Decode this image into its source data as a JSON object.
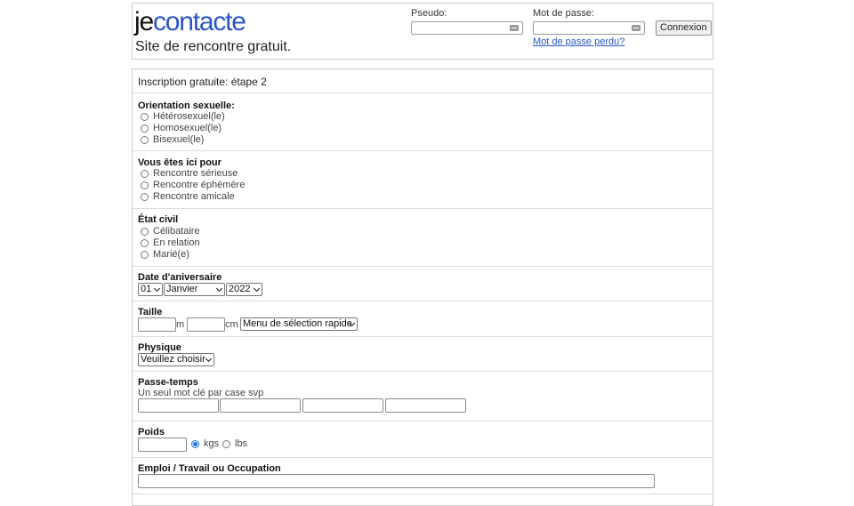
{
  "header": {
    "logo_je": "je",
    "logo_contact": "contacte",
    "tagline": "Site de rencontre gratuit.",
    "pseudo_label": "Pseudo:",
    "password_label": "Mot de passe:",
    "login_button": "Connexion",
    "forgot_link": "Mot de passe perdu?"
  },
  "form": {
    "title": "Inscription gratuite: étape 2",
    "orientation": {
      "title": "Orientation sexuelle:",
      "options": [
        "Hétérosexuel(le)",
        "Homosexuel(le)",
        "Bisexuel(le)"
      ]
    },
    "purpose": {
      "title": "Vous êtes ici pour",
      "options": [
        "Rencontre sérieuse",
        "Rencontre éphémère",
        "Rencontre amicale"
      ]
    },
    "civil": {
      "title": "État civil",
      "options": [
        "Célibataire",
        "En relation",
        "Marié(e)"
      ]
    },
    "birthday": {
      "title": "Date d'aniversaire",
      "day": "01",
      "month": "Janvier",
      "year": "2022"
    },
    "height": {
      "title": "Taille",
      "unit_m": "m",
      "unit_cm": "cm",
      "quick_select": "Menu de sélection rapide"
    },
    "physique": {
      "title": "Physique",
      "select": "Veuillez choisir"
    },
    "hobbies": {
      "title": "Passe-temps",
      "hint": "Un seul mot clé par case svp"
    },
    "weight": {
      "title": "Poids",
      "unit_kgs": "kgs",
      "unit_lbs": "lbs",
      "selected_unit": "kgs"
    },
    "job": {
      "title": "Emploi / Travail ou Occupation"
    }
  },
  "colors": {
    "brand_blue": "#2a55c9",
    "radio_checked": "#1a73e8",
    "border": "#cccccc"
  }
}
